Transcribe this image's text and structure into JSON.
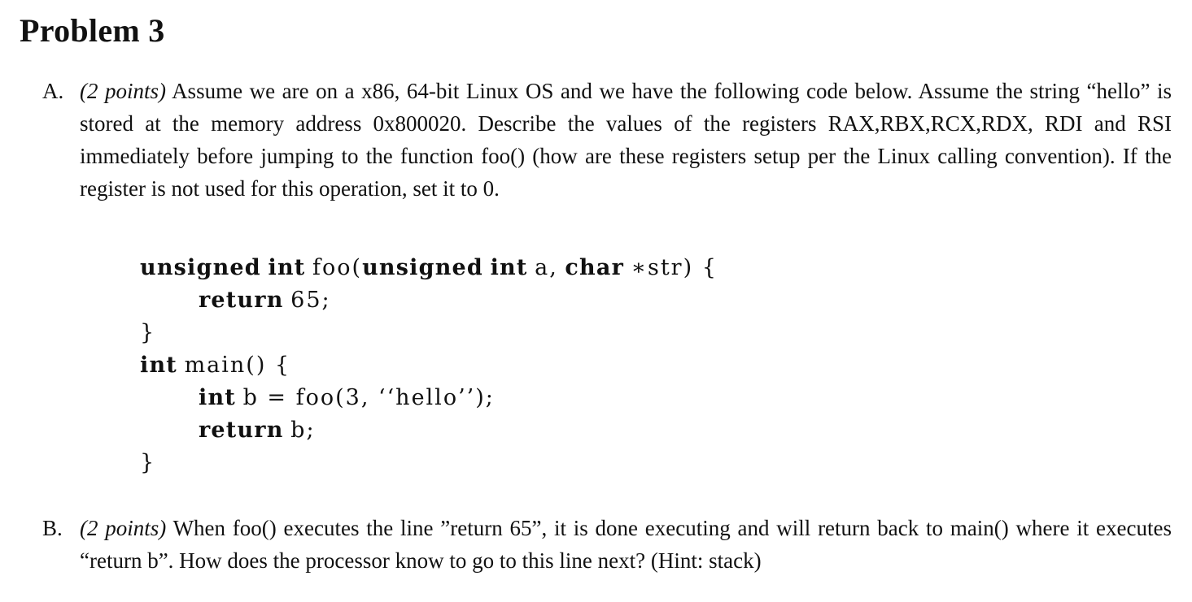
{
  "title": "Problem 3",
  "part_a": {
    "label": "A.",
    "points": "(2 points)",
    "text": "Assume we are on a x86, 64-bit Linux OS and we have the following code below. Assume the string “hello” is stored at the memory address 0x800020. Describe the values of the registers RAX,RBX,RCX,RDX, RDI and RSI immediately before jumping to the function foo() (how are these registers setup per the Linux calling convention). If the register is not used for this operation, set it to 0."
  },
  "code": {
    "line1": {
      "kw1": "unsigned",
      "kw2": "int",
      "fn": "foo(",
      "kw3": "unsigned",
      "kw4": "int",
      "arg1": "a,",
      "kw5": "char",
      "arg2": "∗str) {"
    },
    "line2": {
      "kw": "return",
      "rest": "65;"
    },
    "line3": "}",
    "line4": {
      "kw": "int",
      "rest": "main() {"
    },
    "line5": {
      "kw": "int",
      "rest": "b = foo(3, ‘‘hello’’);"
    },
    "line6": {
      "kw": "return",
      "rest": "b;"
    },
    "line7": "}"
  },
  "part_b": {
    "label": "B.",
    "points": "(2 points)",
    "text": "When foo() executes the line ”return 65”, it is done executing and will return back to main() where it executes “return b”. How does the processor know to go to this line next? (Hint: stack)"
  }
}
